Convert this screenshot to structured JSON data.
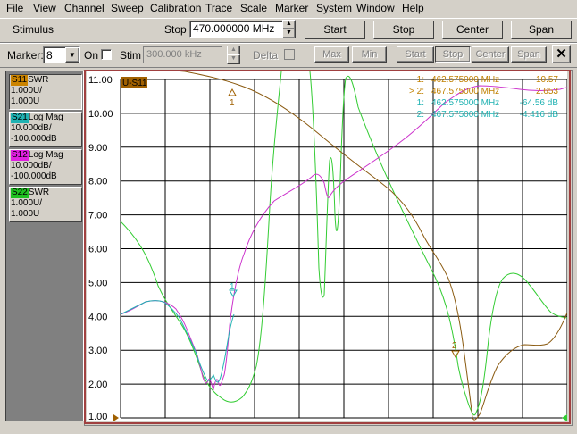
{
  "menu": [
    "File",
    "View",
    "Channel",
    "Sweep",
    "Calibration",
    "Trace",
    "Scale",
    "Marker",
    "System",
    "Window",
    "Help"
  ],
  "stimulus": {
    "label": "Stimulus",
    "field_label": "Stop",
    "value": "470.000000 MHz",
    "buttons": [
      {
        "label": "Start",
        "color": "#ffff00"
      },
      {
        "label": "Stop",
        "color": "#66cc66"
      },
      {
        "label": "Center",
        "color": "#9999ff"
      },
      {
        "label": "Span",
        "color": "#ff6699"
      }
    ]
  },
  "markerbar": {
    "marker_label": "Marker:",
    "marker_value": "8",
    "on_label": "On",
    "stim_label": "Stim",
    "stim_value": "300.000 kHz",
    "delta_label": "Delta",
    "buttons": [
      "Max",
      "Min",
      "Start",
      "Stop",
      "Center",
      "Span"
    ],
    "close": "✕"
  },
  "traces": [
    {
      "id": "S11",
      "format": "SWR",
      "line1": "1.000U/",
      "line2": "1.000U",
      "color": "#cc8400"
    },
    {
      "id": "S21",
      "format": "Log Mag",
      "line1": "10.000dB/",
      "line2": "-100.000dB",
      "color": "#20b2b2"
    },
    {
      "id": "S12",
      "format": "Log Mag",
      "line1": "10.000dB/",
      "line2": "-100.000dB",
      "color": "#e020e0"
    },
    {
      "id": "S22",
      "format": "SWR",
      "line1": "1.000U/",
      "line2": "1.000U",
      "color": "#20c020"
    }
  ],
  "chart_data": {
    "type": "line",
    "title": "U-S11",
    "ylim": [
      1,
      11
    ],
    "yticks": [
      "11.00",
      "10.00",
      "9.00",
      "8.00",
      "7.00",
      "6.00",
      "5.00",
      "4.00",
      "3.00",
      "2.00",
      "1.00"
    ],
    "marker_readouts": [
      {
        "label": "1:",
        "freq": "462.575000 MHz",
        "value": "10.57",
        "color": "#c08000"
      },
      {
        "label": "> 2:",
        "freq": "467.575000 MHz",
        "value": "2.653",
        "color": "#c08000"
      },
      {
        "label": "1:",
        "freq": "462.575000 MHz",
        "value": "-64.56 dB",
        "color": "#20b2b2"
      },
      {
        "label": "2:",
        "freq": "467.575000 MHz",
        "value": "-4.416 dB",
        "color": "#20b2b2"
      }
    ],
    "marker_flags": [
      "1",
      "1",
      "2"
    ]
  },
  "colors": {
    "s11": "#a06000",
    "s12": "#c020c0",
    "s21": "#20a0a0",
    "s22": "#30c030"
  }
}
